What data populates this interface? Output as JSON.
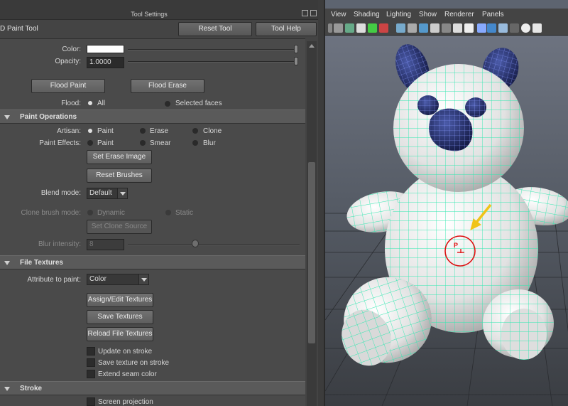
{
  "tool_settings": {
    "title": "Tool Settings",
    "tool_name": "D Paint Tool",
    "reset_tool": "Reset Tool",
    "tool_help": "Tool Help",
    "color_label": "Color:",
    "color_value": "#ffffff",
    "opacity_label": "Opacity:",
    "opacity_value": "1.0000",
    "flood_paint": "Flood Paint",
    "flood_erase": "Flood Erase",
    "flood_label": "Flood:",
    "flood_all": "All",
    "flood_selected": "Selected faces"
  },
  "paint_operations": {
    "header": "Paint Operations",
    "artisan_label": "Artisan:",
    "artisan_options": [
      "Paint",
      "Erase",
      "Clone"
    ],
    "artisan_selected": "Paint",
    "effects_label": "Paint Effects:",
    "effects_options": [
      "Paint",
      "Smear",
      "Blur"
    ],
    "set_erase_image": "Set Erase Image",
    "reset_brushes": "Reset Brushes",
    "blend_label": "Blend mode:",
    "blend_value": "Default",
    "clone_label": "Clone brush mode:",
    "clone_options": [
      "Dynamic",
      "Static"
    ],
    "set_clone_source": "Set Clone Source",
    "blur_label": "Blur intensity:",
    "blur_value": "8",
    "blur_fraction": 0.5
  },
  "file_textures": {
    "header": "File Textures",
    "attr_label": "Attribute to paint:",
    "attr_value": "Color",
    "assign": "Assign/Edit Textures",
    "save": "Save Textures",
    "reload": "Reload File Textures",
    "checks": [
      "Update on stroke",
      "Save texture on stroke",
      "Extend seam color"
    ]
  },
  "stroke": {
    "header": "Stroke",
    "checks": [
      "Screen projection"
    ]
  },
  "viewport": {
    "menu": [
      "View",
      "Shading",
      "Lighting",
      "Show",
      "Renderer",
      "Panels"
    ],
    "brush_marker": "P",
    "accent_wire": "#33e8b0",
    "brush_color": "#dd1111",
    "arrow_color": "#f0c419"
  }
}
